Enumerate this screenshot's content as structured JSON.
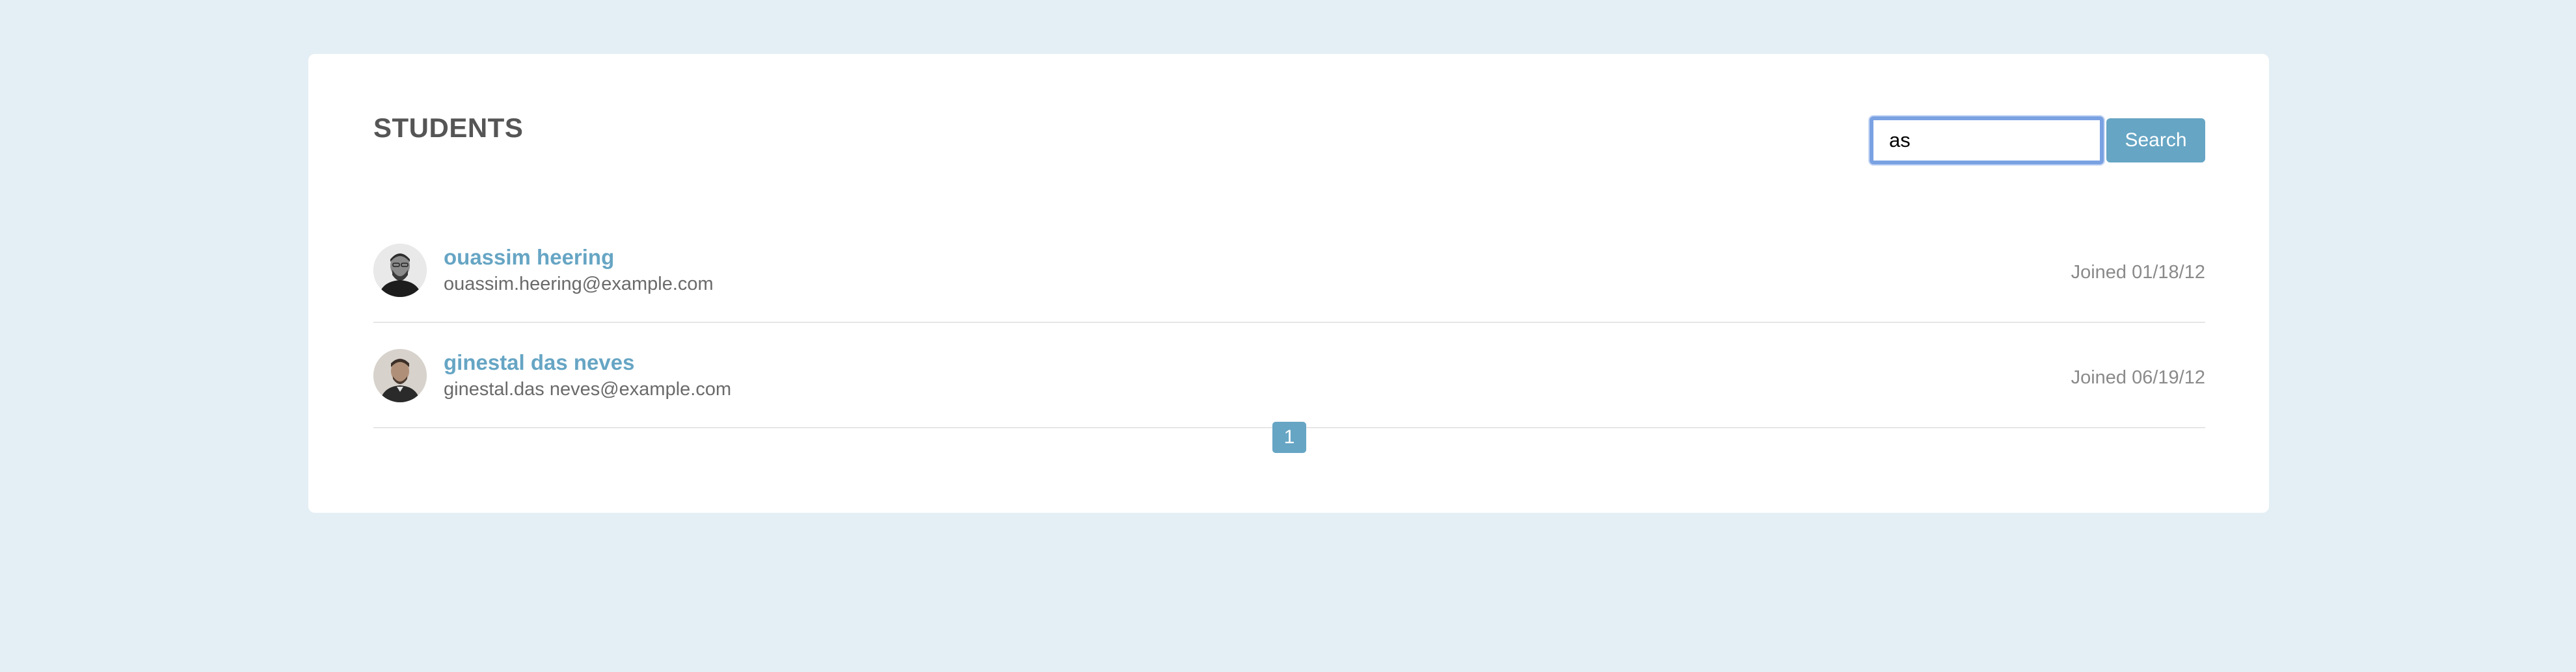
{
  "header": {
    "title": "STUDENTS"
  },
  "search": {
    "value": "as",
    "placeholder": "",
    "button_label": "Search"
  },
  "students": [
    {
      "name": "ouassim heering",
      "email": "ouassim.heering@example.com",
      "joined": "Joined 01/18/12",
      "avatar_icon": "person-avatar-icon"
    },
    {
      "name": "ginestal das neves",
      "email": "ginestal.das neves@example.com",
      "joined": "Joined 06/19/12",
      "avatar_icon": "person-avatar-icon"
    }
  ],
  "pagination": {
    "pages": [
      "1"
    ],
    "current": "1"
  },
  "colors": {
    "background": "#e4eff5",
    "accent": "#66a5c4",
    "card": "#ffffff",
    "title": "#555555",
    "focus_ring": "#7aa2e3"
  }
}
